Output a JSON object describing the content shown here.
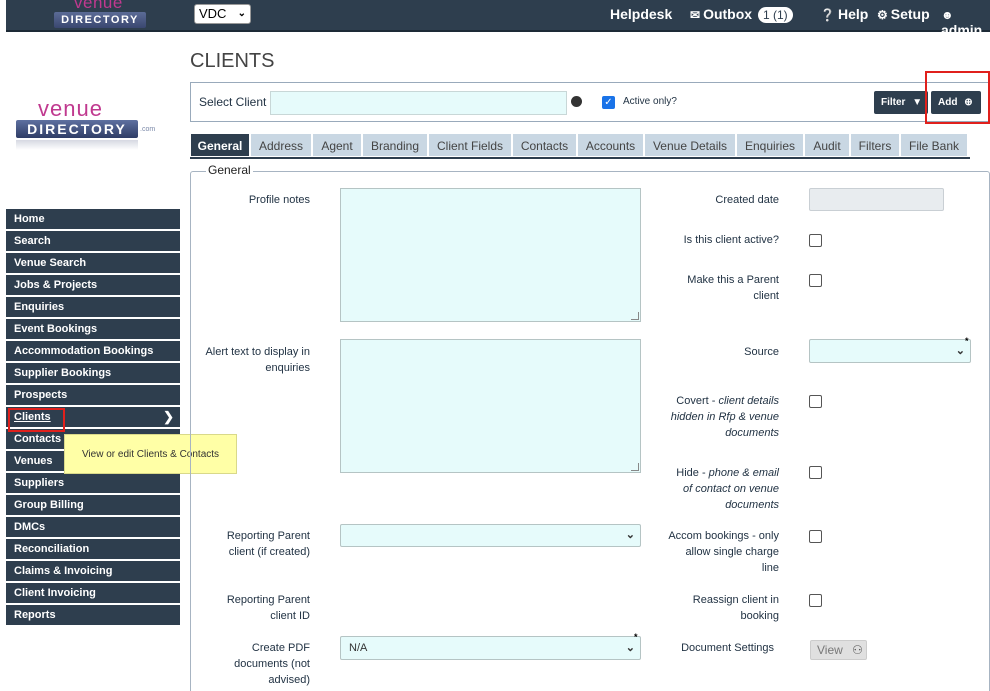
{
  "topbar": {
    "logo_top": "venue",
    "logo_bottom": "DIRECTORY",
    "region_select": "VDC",
    "helpdesk": "Helpdesk",
    "outbox": "Outbox",
    "outbox_badge": "1 (1)",
    "help": "Help",
    "setup": "Setup",
    "user": "admin"
  },
  "sidebar": {
    "logo_top": "venue",
    "logo_bottom": "DIRECTORY",
    "logo_suffix": ".com",
    "items": [
      {
        "label": "Home"
      },
      {
        "label": "Search"
      },
      {
        "label": "Venue Search"
      },
      {
        "label": "Jobs & Projects"
      },
      {
        "label": "Enquiries"
      },
      {
        "label": "Event Bookings"
      },
      {
        "label": "Accommodation Bookings"
      },
      {
        "label": "Supplier Bookings"
      },
      {
        "label": "Prospects"
      },
      {
        "label": "Clients"
      },
      {
        "label": "Contacts"
      },
      {
        "label": "Venues"
      },
      {
        "label": "Suppliers"
      },
      {
        "label": "Group Billing"
      },
      {
        "label": "DMCs"
      },
      {
        "label": "Reconciliation"
      },
      {
        "label": "Claims & Invoicing"
      },
      {
        "label": "Client Invoicing"
      },
      {
        "label": "Reports"
      }
    ],
    "tooltip": "View or edit Clients & Contacts"
  },
  "main": {
    "title": "CLIENTS",
    "select_client_label": "Select Client",
    "select_client_value": "",
    "active_only_label": "Active only?",
    "active_only_checked": true,
    "filter_label": "Filter",
    "add_label": "Add",
    "tabs": [
      {
        "label": "General"
      },
      {
        "label": "Address"
      },
      {
        "label": "Agent"
      },
      {
        "label": "Branding"
      },
      {
        "label": "Client Fields"
      },
      {
        "label": "Contacts"
      },
      {
        "label": "Accounts"
      },
      {
        "label": "Venue Details"
      },
      {
        "label": "Enquiries"
      },
      {
        "label": "Audit"
      },
      {
        "label": "Filters"
      },
      {
        "label": "File Bank"
      }
    ],
    "section_title": "General",
    "fields": {
      "profile_notes": "Profile notes",
      "alert_text_1": "Alert text to display in",
      "alert_text_2": "enquiries",
      "reporting_parent_1": "Reporting Parent",
      "reporting_parent_2": "client (if created)",
      "reporting_parent_id_1": "Reporting Parent",
      "reporting_parent_id_2": "client ID",
      "create_pdf_1": "Create PDF",
      "create_pdf_2": "documents (not",
      "create_pdf_3": "advised)",
      "create_pdf_value": "N/A",
      "created_date": "Created date",
      "is_active": "Is this client active?",
      "make_parent_1": "Make this a Parent",
      "make_parent_2": "client",
      "source": "Source",
      "covert_1": "Covert - ",
      "covert_1i": "client details",
      "covert_2i": "hidden in Rfp & venue",
      "covert_3i": "documents",
      "hide_1": "Hide - ",
      "hide_1i": "phone & email",
      "hide_2i": "of contact on venue",
      "hide_3i": "documents",
      "accom_1": "Accom bookings - only",
      "accom_2": "allow single charge",
      "accom_3": "line",
      "reassign_1": "Reassign client in",
      "reassign_2": "booking",
      "doc_settings": "Document Settings",
      "view_label": "View"
    }
  },
  "colors": {
    "nav_bg": "#2e3e4e",
    "input_bg": "#e6fbfb",
    "highlight": "#e0201c",
    "tooltip_bg": "#ffffa6"
  }
}
